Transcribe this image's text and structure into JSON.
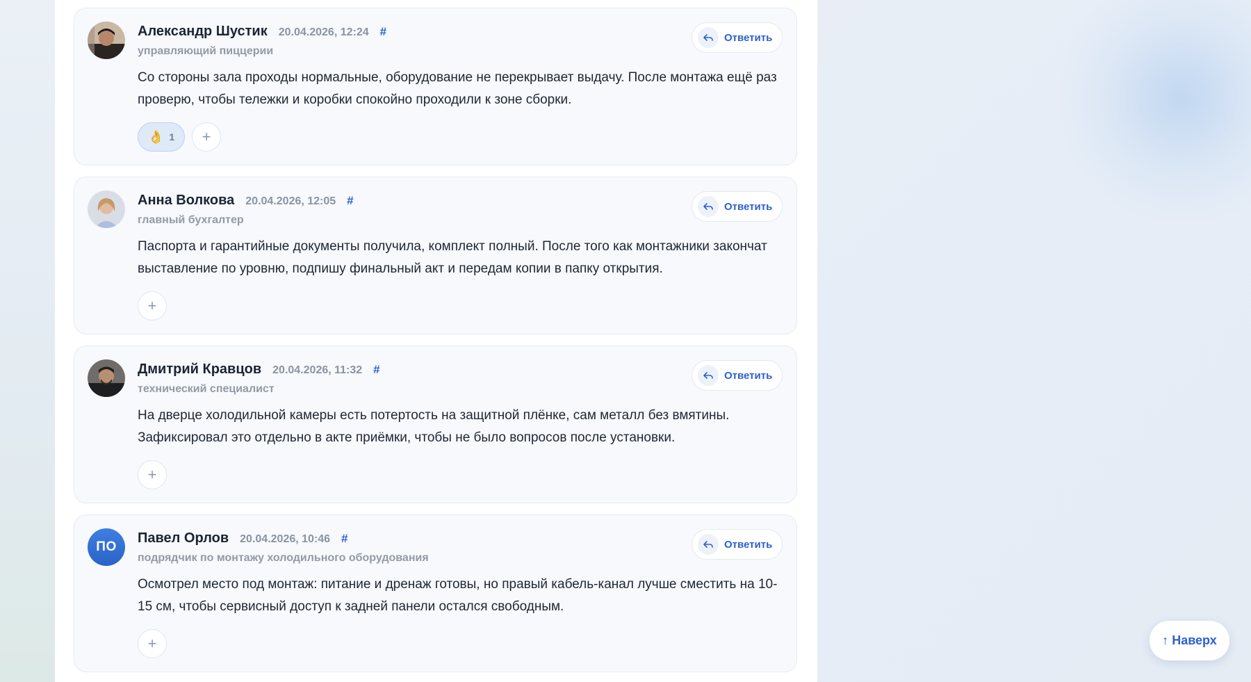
{
  "comments": [
    {
      "author": "Александр Шустик",
      "datetime": "20.04.2026, 12:24",
      "anchor": "#",
      "role": "управляющий пиццерии",
      "text": "Со стороны зала проходы нормальные, оборудование не перекрывает выдачу. После монтажа ещё раз проверю, чтобы тележки и коробки спокойно проходили к зоне сборки.",
      "reply_label": "Ответить",
      "reaction": {
        "emoji": "👌",
        "count": "1"
      },
      "add_reaction": "+"
    },
    {
      "author": "Анна Волкова",
      "datetime": "20.04.2026, 12:05",
      "anchor": "#",
      "role": "главный бухгалтер",
      "text": "Паспорта и гарантийные документы получила, комплект полный. После того как монтажники закончат выставление по уровню, подпишу финальный акт и передам копии в папку открытия.",
      "reply_label": "Ответить",
      "add_reaction": "+"
    },
    {
      "author": "Дмитрий Кравцов",
      "datetime": "20.04.2026, 11:32",
      "anchor": "#",
      "role": "технический специалист",
      "text": "На дверце холодильной камеры есть потертость на защитной плёнке, сам металл без вмятины. Зафиксировал это отдельно в акте приёмки, чтобы не было вопросов после установки.",
      "reply_label": "Ответить",
      "add_reaction": "+"
    },
    {
      "author": "Павел Орлов",
      "initials": "ПО",
      "datetime": "20.04.2026, 10:46",
      "anchor": "#",
      "role": "подрядчик по монтажу холодильного оборудования",
      "text": "Осмотрел место под монтаж: питание и дренаж готовы, но правый кабель-канал лучше сместить на 10-15 см, чтобы сервисный доступ к задней панели остался свободным.",
      "reply_label": "Ответить",
      "add_reaction": "+"
    }
  ],
  "to_top_label": "↑ Наверх",
  "colors": {
    "accent": "#2d5fd0",
    "card_bg": "#f7f9fc",
    "reaction_bg": "#dfeaf8",
    "initials_avatar": "#3372d8"
  },
  "icons": [
    "reply-icon",
    "avatar-photo",
    "plus-icon",
    "arrow-up-icon"
  ]
}
